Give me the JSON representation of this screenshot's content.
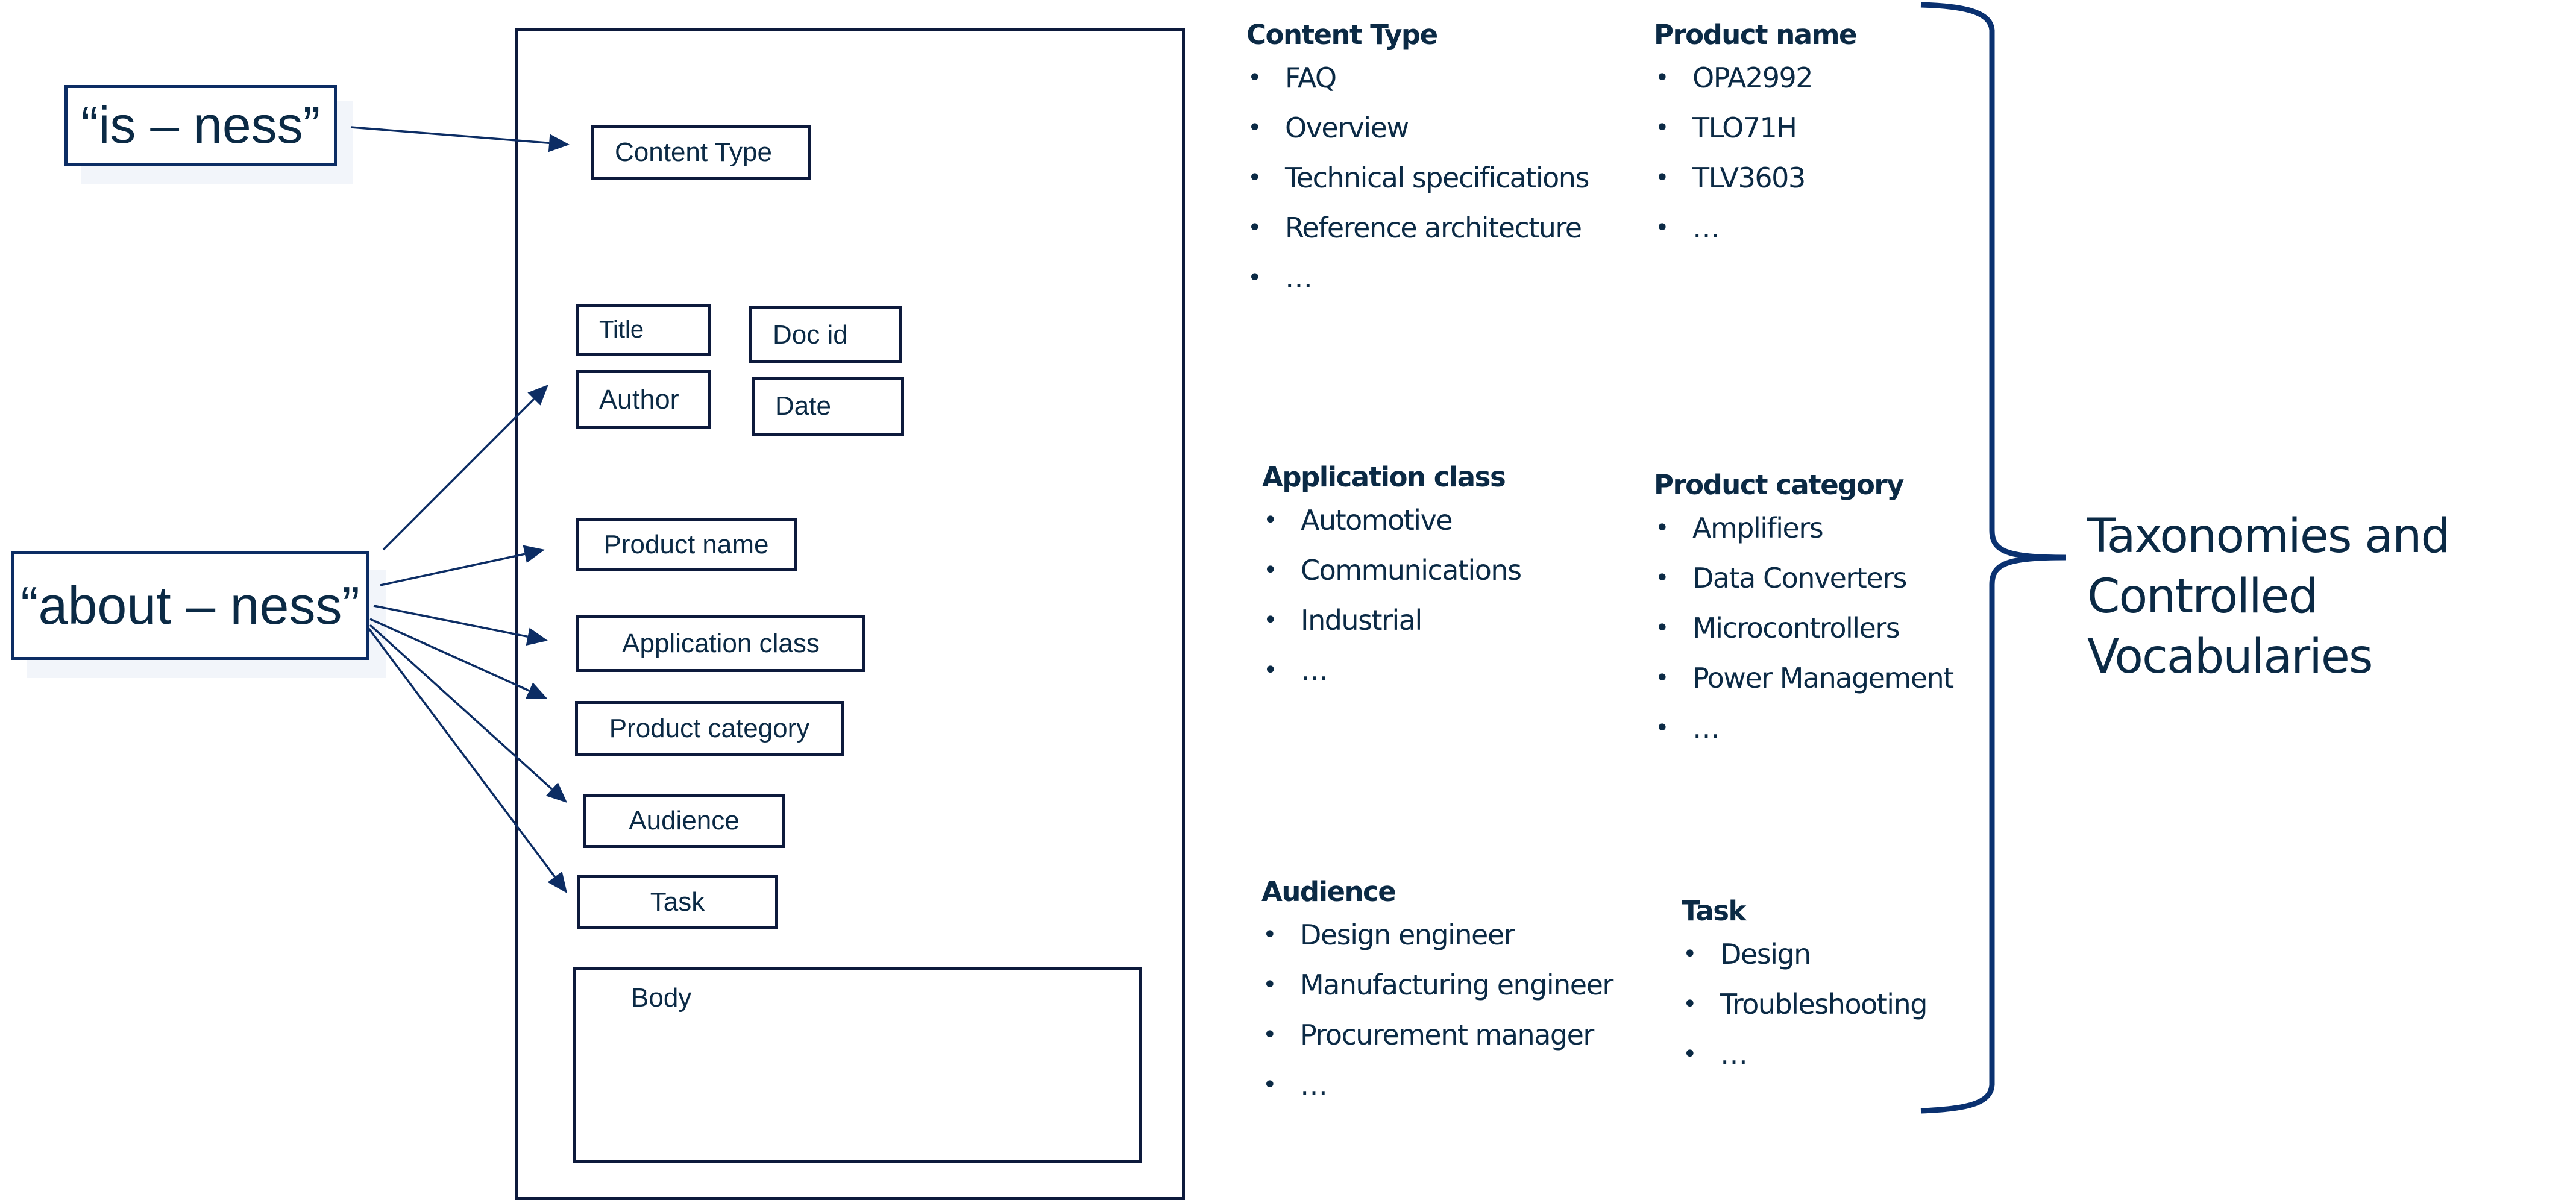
{
  "colors": {
    "navy": "#0c2d64",
    "text": "#0b2a45",
    "frame": "#0d1a3c",
    "shadow": "#f2f5fa",
    "brace": "#0a3170"
  },
  "callouts": {
    "isness": "“is – ness”",
    "aboutness": "“about – ness”"
  },
  "document": {
    "fields": {
      "content_type": "Content Type",
      "title": "Title",
      "doc_id": "Doc id",
      "author": "Author",
      "date": "Date",
      "product_name": "Product name",
      "application_class": "Application class",
      "product_category": "Product category",
      "audience": "Audience",
      "task": "Task",
      "body": "Body"
    }
  },
  "vocabularies": {
    "content_type": {
      "title": "Content Type",
      "items": [
        "FAQ",
        "Overview",
        "Technical specifications",
        "Reference architecture",
        "…"
      ]
    },
    "product_name": {
      "title": "Product name",
      "items": [
        "OPA2992",
        "TLO71H",
        "TLV3603",
        "…"
      ]
    },
    "application_class": {
      "title": "Application class",
      "items": [
        "Automotive",
        "Communications",
        "Industrial",
        "…"
      ]
    },
    "product_category": {
      "title": "Product category",
      "items": [
        "Amplifiers",
        "Data Converters",
        "Microcontrollers",
        "Power Management",
        "…"
      ]
    },
    "audience": {
      "title": "Audience",
      "items": [
        "Design engineer",
        "Manufacturing engineer",
        "Procurement manager",
        "…"
      ]
    },
    "task": {
      "title": "Task",
      "items": [
        "Design",
        "Troubleshooting",
        "…"
      ]
    }
  },
  "bullet_glyph": "•",
  "summary_label": {
    "lines": [
      "Taxonomies and",
      "Controlled",
      "Vocabularies"
    ]
  }
}
